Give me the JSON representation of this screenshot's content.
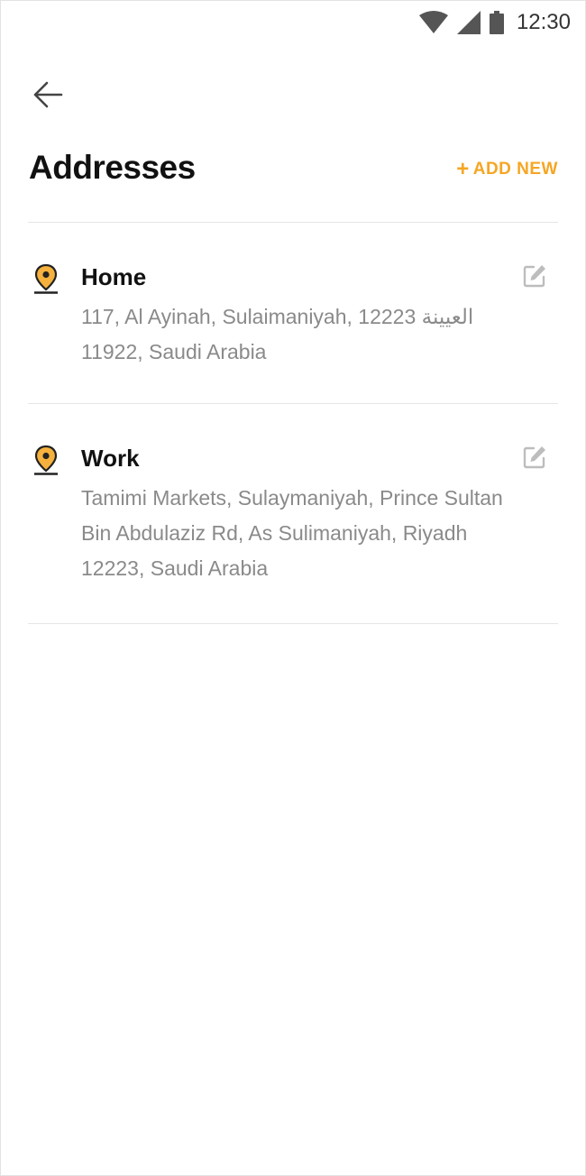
{
  "status_bar": {
    "time": "12:30",
    "icons": [
      "wifi-icon",
      "signal-icon",
      "battery-icon"
    ]
  },
  "header": {
    "back_icon": "back-arrow-icon",
    "title": "Addresses",
    "add_new_label": "ADD NEW",
    "add_new_icon": "plus"
  },
  "addresses": [
    {
      "label": "Home",
      "address": "117, Al Ayinah, Sulaimaniyah, 12223 العيينة 11922, Saudi Arabia",
      "icon": "location-pin-icon",
      "edit_icon": "edit-icon"
    },
    {
      "label": "Work",
      "address": "Tamimi Markets, Sulaymaniyah, Prince Sultan Bin Abdulaziz Rd, As Sulimaniyah, Riyadh 12223, Saudi Arabia",
      "icon": "location-pin-icon",
      "edit_icon": "edit-icon"
    }
  ],
  "colors": {
    "accent": "#f5a623",
    "title": "#111111",
    "secondary_text": "#8a8a8a",
    "divider": "#e6e6e6",
    "icon_gray": "#bdbdbd"
  }
}
